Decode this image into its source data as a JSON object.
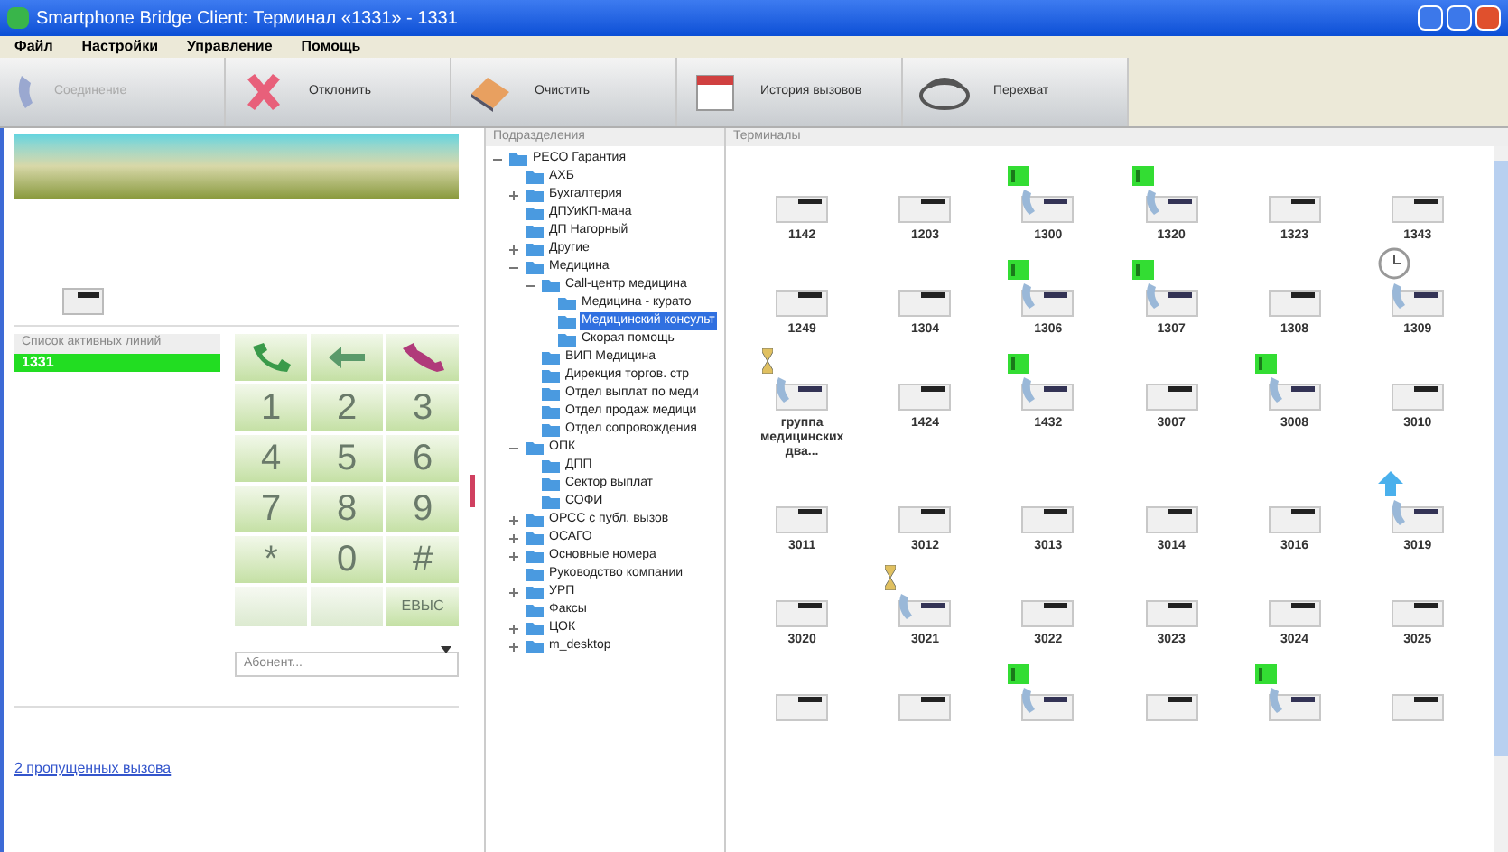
{
  "window": {
    "title": "Smartphone Bridge Client: Терминал «1331» - 1331"
  },
  "menu": [
    "Файл",
    "Настройки",
    "Управление",
    "Помощь"
  ],
  "toolbar": [
    {
      "label": "Соединение",
      "disabled": true
    },
    {
      "label": "Отклонить",
      "disabled": false
    },
    {
      "label": "Очистить",
      "disabled": false
    },
    {
      "label": "История вызовов",
      "disabled": false
    },
    {
      "label": "Перехват",
      "disabled": false
    }
  ],
  "lines": {
    "header": "Список активных линий",
    "items": [
      {
        "label": "1331",
        "selected": true
      }
    ]
  },
  "keypad": {
    "actions": [
      {
        "kind": "call"
      },
      {
        "kind": "transfer"
      },
      {
        "kind": "hangup"
      }
    ],
    "keys": [
      "1",
      "2",
      "3",
      "4",
      "5",
      "6",
      "7",
      "8",
      "9",
      "*",
      "0",
      "#"
    ],
    "bottom": [
      {
        "disabled": true
      },
      {
        "disabled": true
      },
      {
        "label": "ЕВЫС",
        "disabled": false
      }
    ],
    "combo": {
      "placeholder": "Абонент..."
    }
  },
  "missed_link": "2 пропущенных вызова",
  "tree": {
    "header": "Подразделения",
    "items": [
      {
        "label": "РЕСО Гарантия",
        "expanded": true,
        "selected": false,
        "children": [
          {
            "label": "АХБ",
            "selected": false
          },
          {
            "label": "Бухгалтерия",
            "expanded": false,
            "selected": false
          },
          {
            "label": "ДПУиКП-мана",
            "selected": false
          },
          {
            "label": "ДП Нагорный",
            "selected": false
          },
          {
            "label": "Другие",
            "expanded": false,
            "selected": false
          },
          {
            "label": "Медицина",
            "expanded": true,
            "selected": false,
            "children": [
              {
                "label": "Call-центр медицина",
                "expanded": true,
                "selected": false,
                "children": [
                  {
                    "label": "Медицина - курато",
                    "selected": false
                  },
                  {
                    "label": "Медицинский консульт",
                    "selected": true
                  },
                  {
                    "label": "Скорая помощь",
                    "selected": false
                  }
                ]
              },
              {
                "label": "ВИП Медицина",
                "selected": false
              },
              {
                "label": "Дирекция торгов. стр",
                "selected": false
              },
              {
                "label": "Отдел выплат по меди",
                "selected": false
              },
              {
                "label": "Отдел продаж медици",
                "selected": false
              },
              {
                "label": "Отдел сопровождения",
                "selected": false
              }
            ]
          },
          {
            "label": "ОПК",
            "expanded": true,
            "selected": false,
            "children": [
              {
                "label": "ДПП",
                "selected": false
              },
              {
                "label": "Сектор выплат",
                "selected": false
              },
              {
                "label": "СОФИ",
                "selected": false
              }
            ]
          },
          {
            "label": "ОРСС с публ. вызов",
            "expanded": false,
            "selected": false
          },
          {
            "label": "ОСАГО",
            "expanded": false,
            "selected": false
          },
          {
            "label": "Основные номера",
            "expanded": false,
            "selected": false
          },
          {
            "label": "Руководство компании",
            "selected": false
          },
          {
            "label": "УРП",
            "expanded": false,
            "selected": false
          },
          {
            "label": "Факсы",
            "selected": false
          },
          {
            "label": "ЦОК",
            "expanded": false,
            "selected": false
          },
          {
            "label": "m_desktop",
            "expanded": false,
            "selected": false
          }
        ]
      }
    ]
  },
  "terminals": {
    "header": "Терминалы",
    "items": [
      {
        "label": "1142",
        "kind": "idle"
      },
      {
        "label": "1203",
        "kind": "idle"
      },
      {
        "label": "1300",
        "kind": "talking"
      },
      {
        "label": "1320",
        "kind": "talking"
      },
      {
        "label": "1323",
        "kind": "idle"
      },
      {
        "label": "1343",
        "kind": "idle"
      },
      {
        "label": "1249",
        "kind": "idle"
      },
      {
        "label": "1304",
        "kind": "idle"
      },
      {
        "label": "1306",
        "kind": "talking"
      },
      {
        "label": "1307",
        "kind": "talking"
      },
      {
        "label": "1308",
        "kind": "idle"
      },
      {
        "label": "1309",
        "kind": "away"
      },
      {
        "label": "группа медицинских два...",
        "kind": "ringing"
      },
      {
        "label": "1424",
        "kind": "idle"
      },
      {
        "label": "1432",
        "kind": "talking"
      },
      {
        "label": "3007",
        "kind": "idle"
      },
      {
        "label": "3008",
        "kind": "talking"
      },
      {
        "label": "3010",
        "kind": "idle"
      },
      {
        "label": "3011",
        "kind": "idle"
      },
      {
        "label": "3012",
        "kind": "idle"
      },
      {
        "label": "3013",
        "kind": "idle"
      },
      {
        "label": "3014",
        "kind": "idle"
      },
      {
        "label": "3016",
        "kind": "idle"
      },
      {
        "label": "3019",
        "kind": "transfer"
      },
      {
        "label": "3020",
        "kind": "idle"
      },
      {
        "label": "3021",
        "kind": "ringing"
      },
      {
        "label": "3022",
        "kind": "idle"
      },
      {
        "label": "3023",
        "kind": "idle"
      },
      {
        "label": "3024",
        "kind": "idle"
      },
      {
        "label": "3025",
        "kind": "idle"
      },
      {
        "kind": "idle"
      },
      {
        "kind": "idle"
      },
      {
        "kind": "talking"
      },
      {
        "kind": "idle"
      },
      {
        "kind": "talking"
      },
      {
        "kind": "idle"
      }
    ]
  }
}
